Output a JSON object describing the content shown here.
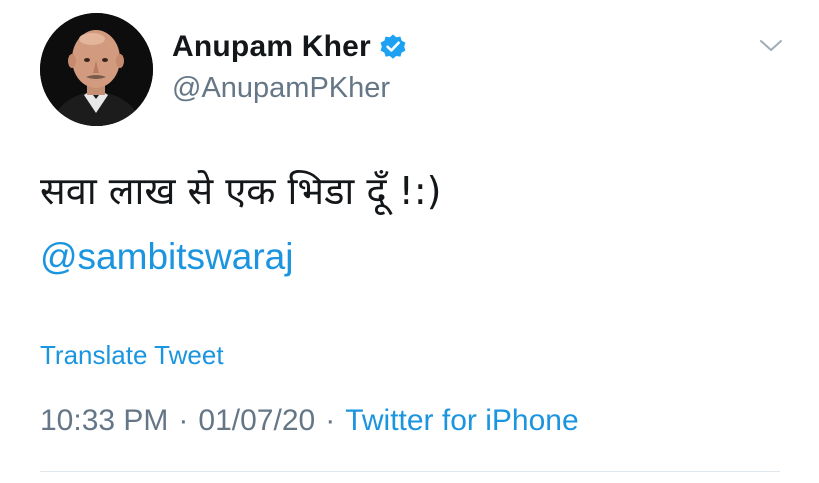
{
  "author": {
    "display_name": "Anupam Kher",
    "handle": "@AnupamPKher",
    "verified": true,
    "avatar_icon": "profile-photo"
  },
  "tweet": {
    "text": "सवा लाख से एक भिडा दूँ !:)",
    "mention": "@sambitswaraj",
    "translate_label": "Translate Tweet",
    "time": "10:33 PM",
    "date": "01/07/20",
    "separator": "·",
    "source": "Twitter for iPhone"
  },
  "icons": {
    "menu": "chevron-down-icon",
    "verified": "verified-badge-icon"
  },
  "colors": {
    "link": "#1b95e0",
    "text": "#14171a",
    "muted": "#657786",
    "verified": "#1da1f2",
    "divider": "#e1e8ed"
  }
}
